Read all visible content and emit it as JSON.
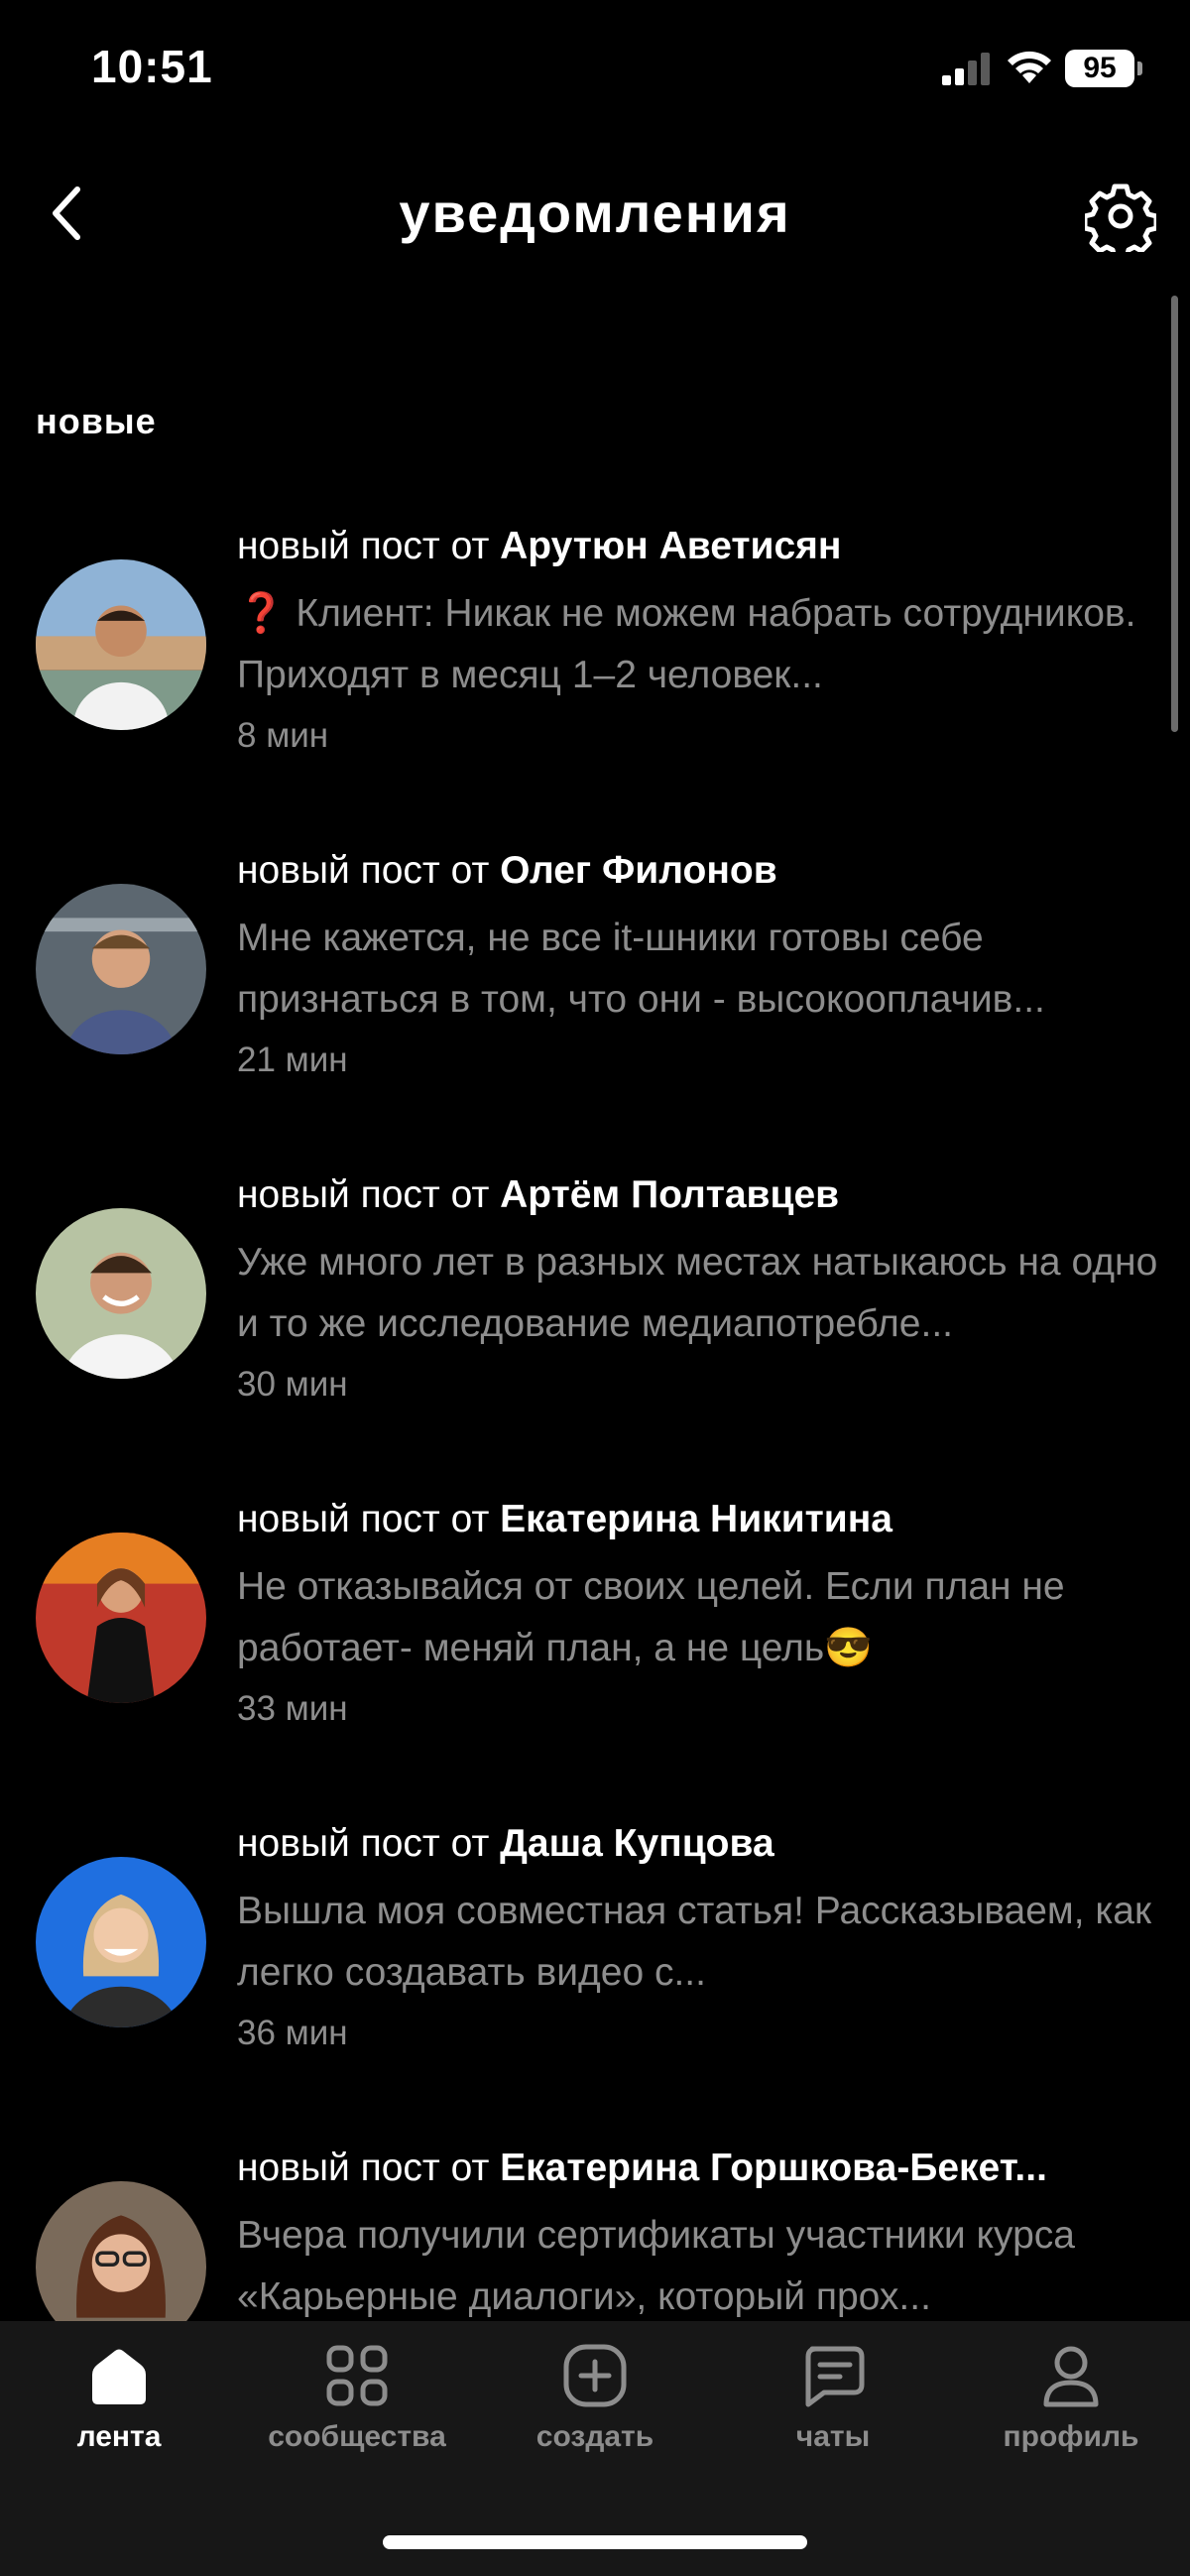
{
  "status_bar": {
    "time": "10:51",
    "battery": "95"
  },
  "header": {
    "title": "уведомления",
    "back_icon": "chevron-left-icon",
    "settings_icon": "gear-icon"
  },
  "section": {
    "label": "новые"
  },
  "notifications": [
    {
      "prefix": "новый пост от ",
      "author": "Арутюн Аветисян",
      "emoji": "❓",
      "body": "Клиент: Никак не можем набрать сотрудников. Приходят в месяц 1–2 человек...",
      "time": "8 мин"
    },
    {
      "prefix": "новый пост от ",
      "author": "Олег Филонов",
      "emoji": "",
      "body": "Мне кажется, не все it-шники готовы себе признаться в том, что они - высокооплачив...",
      "time": "21 мин"
    },
    {
      "prefix": "новый пост от ",
      "author": "Артём Полтавцев",
      "emoji": "",
      "body": "Уже много лет в разных местах натыкаюсь на одно и то же исследование медиапотребле...",
      "time": "30 мин"
    },
    {
      "prefix": "новый пост от ",
      "author": "Екатерина Никитина",
      "emoji": "",
      "body": "Не отказывайся от своих целей. Если план не работает- меняй план, а не цель😎",
      "time": "33 мин"
    },
    {
      "prefix": "новый пост от ",
      "author": "Даша Купцова",
      "emoji": "",
      "body": "Вышла моя совместная статья! Рассказываем, как легко создавать видео с...",
      "time": "36 мин"
    },
    {
      "prefix": "новый пост от ",
      "author": "Екатерина Горшкова-Бекет...",
      "emoji": "",
      "body": "Вчера получили сертификаты участники курса «Карьерные диалоги», который прох...",
      "time": ""
    }
  ],
  "tabs": [
    {
      "label": "лента",
      "icon": "home-icon",
      "active": true
    },
    {
      "label": "сообщества",
      "icon": "communities-grid-icon",
      "active": false
    },
    {
      "label": "создать",
      "icon": "plus-square-icon",
      "active": false
    },
    {
      "label": "чаты",
      "icon": "chat-bubble-icon",
      "active": false
    },
    {
      "label": "профиль",
      "icon": "profile-icon",
      "active": false
    }
  ]
}
